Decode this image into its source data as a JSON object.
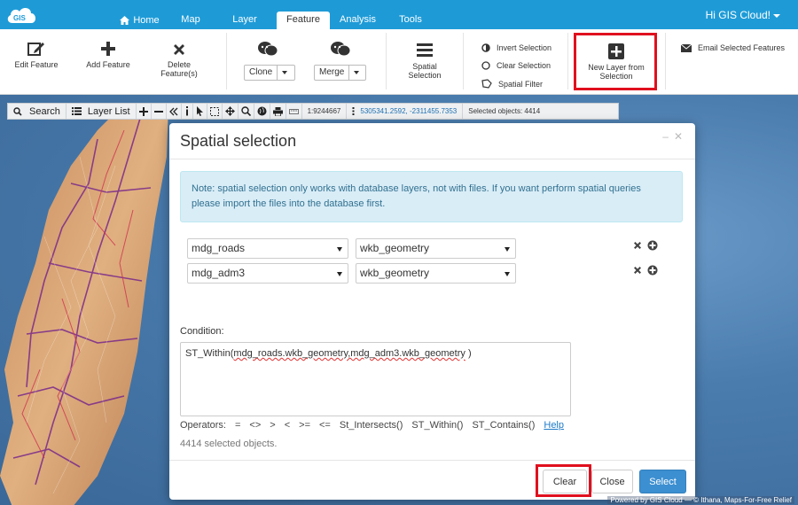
{
  "colors": {
    "topbar": "#1e9bd7",
    "accent_red": "#e0101e",
    "primary_button": "#3c8fd0",
    "note_bg": "#d9edf7"
  },
  "header": {
    "logo_text": "GIS",
    "tabs": [
      {
        "label": "Home",
        "icon": "home-icon"
      },
      {
        "label": "Map"
      },
      {
        "label": "Layer"
      },
      {
        "label": "Feature",
        "active": true
      },
      {
        "label": "Analysis"
      },
      {
        "label": "Tools"
      }
    ],
    "user": "Hi GIS Cloud!"
  },
  "ribbon": {
    "edit_feature": "Edit Feature",
    "add_feature": "Add Feature",
    "delete_feature_1": "Delete",
    "delete_feature_2": "Feature(s)",
    "clone": "Clone",
    "merge": "Merge",
    "spatial_selection_1": "Spatial",
    "spatial_selection_2": "Selection",
    "invert_selection": "Invert Selection",
    "clear_selection": "Clear Selection",
    "spatial_filter": "Spatial Filter",
    "new_layer_1": "New Layer from",
    "new_layer_2": "Selection",
    "email_selected": "Email Selected Features"
  },
  "map_toolbar": {
    "search": "Search",
    "layer_list": "Layer List",
    "scale": "1:9244667",
    "coords": "5305341.2592, -2311455.7353",
    "selected": "Selected objects: 4414"
  },
  "dialog": {
    "title": "Spatial selection",
    "note": "Note: spatial selection only works with database layers, not with files. If you want perform spatial queries please import the files into the database first.",
    "rows": [
      {
        "layer": "mdg_roads",
        "column": "wkb_geometry"
      },
      {
        "layer": "mdg_adm3",
        "column": "wkb_geometry"
      }
    ],
    "condition_label": "Condition:",
    "condition_prefix": "ST_Within(",
    "condition_arg1": "mdg_roads.wkb_geometry,mdg_adm3.wkb_geometry",
    "condition_suffix": " )",
    "operators_label": "Operators:",
    "operators": [
      "=",
      "<>",
      ">",
      "<",
      ">=",
      "<=",
      "St_Intersects()",
      "ST_Within()",
      "ST_Contains()"
    ],
    "help": "Help",
    "count_text": "4414 selected objects.",
    "buttons": {
      "clear": "Clear",
      "close": "Close",
      "select": "Select"
    }
  },
  "attribution": "Powered by GIS Cloud — © Ithana, Maps-For-Free Relief"
}
